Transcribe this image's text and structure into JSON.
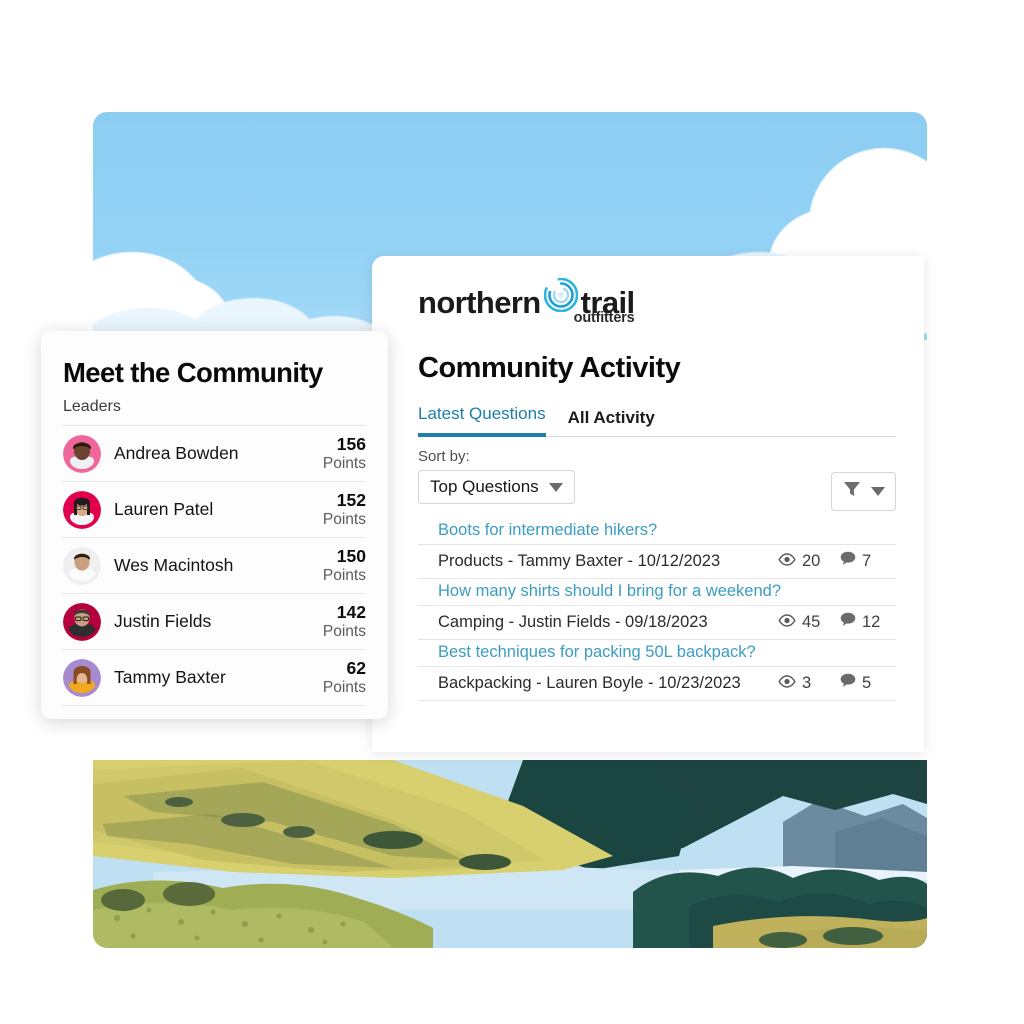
{
  "brand": {
    "logo_word_1": "northern",
    "logo_word_2": "trail",
    "logo_sub": "outfitters",
    "logo_mark_icon": "spiral-circle-icon",
    "accent_teal": "#1d7fa8",
    "link_blue": "#3b9cc4",
    "sky_blue": "#8ccdf2"
  },
  "leaderboard": {
    "title": "Meet the Community",
    "subtitle": "Leaders",
    "points_label": "Points",
    "rows": [
      {
        "name": "Andrea Bowden",
        "points": "156",
        "avatar_bg": "#f0669b",
        "skin": "#6b4430",
        "hair": "#2c1b12",
        "shirt": "#eef1f4"
      },
      {
        "name": "Lauren Patel",
        "points": "152",
        "avatar_bg": "#e0004d",
        "skin": "#d9a887",
        "hair": "#241a19",
        "shirt": "#f2f4f6"
      },
      {
        "name": "Wes Macintosh",
        "points": "150",
        "avatar_bg": "#efeff0",
        "skin": "#caa07c",
        "hair": "#2a2118",
        "shirt": "#fbfbfc"
      },
      {
        "name": "Justin Fields",
        "points": "142",
        "avatar_bg": "#b4003c",
        "skin": "#caa080",
        "hair": "#3b3b3b",
        "shirt": "#2e2e30"
      },
      {
        "name": "Tammy Baxter",
        "points": "62",
        "avatar_bg": "#a78bd0",
        "skin": "#e3b693",
        "hair": "#8a4a22",
        "shirt": "#f0a81e"
      }
    ]
  },
  "activity": {
    "title": "Community Activity",
    "tabs": [
      {
        "label": "Latest Questions",
        "active": true
      },
      {
        "label": "All Activity",
        "active": false
      }
    ],
    "sort": {
      "label": "Sort by:",
      "selected": "Top Questions",
      "caret_icon": "chevron-down-icon"
    },
    "filter": {
      "funnel_icon": "funnel-icon",
      "caret_icon": "chevron-down-icon"
    },
    "questions": [
      {
        "title": "Boots for intermediate hikers?",
        "meta": "Products - Tammy Baxter - 10/12/2023",
        "views": "20",
        "comments": "7"
      },
      {
        "title": "How many shirts should I bring for a weekend?",
        "meta": "Camping - Justin Fields - 09/18/2023",
        "views": "45",
        "comments": "12"
      },
      {
        "title": "Best techniques for packing 50L backpack?",
        "meta": "Backpacking - Lauren Boyle - 10/23/2023",
        "views": "3",
        "comments": "5"
      }
    ],
    "icons": {
      "views": "eye-icon",
      "comments": "comment-bubble-icon"
    }
  },
  "hero": {
    "sky_alt": "blue-sky-with-clouds-banner",
    "landscape_alt": "valley-lake-mountains-illustration"
  }
}
